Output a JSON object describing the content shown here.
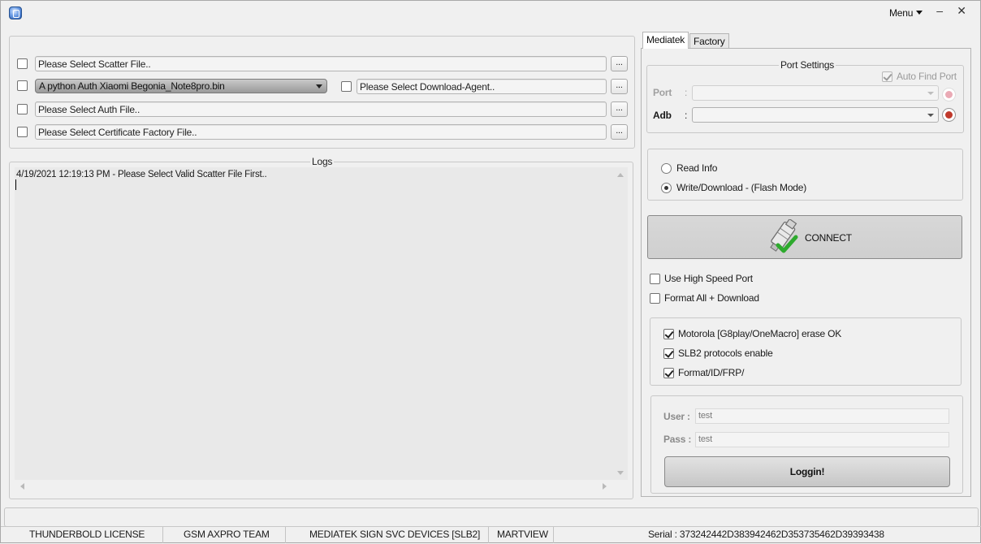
{
  "titlebar": {
    "menu_label": "Menu",
    "minimize_glyph": "–",
    "close_glyph": "✕"
  },
  "files": {
    "scatter_placeholder": "Please Select Scatter File..",
    "preset_selected": "A python Auth Xiaomi Begonia_Note8pro.bin",
    "download_agent_placeholder": "Please Select Download-Agent..",
    "auth_placeholder": "Please Select Auth File..",
    "certificate_placeholder": "Please Select Certificate Factory File..",
    "browse_label": "..."
  },
  "logs": {
    "title": "Logs",
    "lines": [
      "4/19/2021 12:19:13 PM - Please Select Valid Scatter File First.."
    ]
  },
  "tabs": [
    {
      "label": "Mediatek",
      "active": true
    },
    {
      "label": "Factory",
      "active": false
    }
  ],
  "port_settings": {
    "title": "Port Settings",
    "auto_find_label": "Auto Find Port",
    "auto_find_checked": true,
    "port_label": "Port",
    "adb_label": "Adb",
    "colon": ":"
  },
  "mode": {
    "read_info": "Read Info",
    "write_download": "Write/Download - (Flash Mode)",
    "selected": "write_download"
  },
  "connect": {
    "label": "CONNECT"
  },
  "options": {
    "high_speed": "Use High Speed Port",
    "format_all": "Format All + Download"
  },
  "features": [
    {
      "label": "Motorola [G8play/OneMacro] erase OK",
      "checked": true
    },
    {
      "label": "SLB2 protocols enable",
      "checked": true
    },
    {
      "label": "Format/ID/FRP/",
      "checked": true
    }
  ],
  "login": {
    "user_label": "User :",
    "user_value": "test",
    "pass_label": "Pass :",
    "pass_value": "test",
    "button_label": "Loggin!"
  },
  "statusbar": {
    "license": "THUNDERBOLD LICENSE",
    "team": "GSM AXPRO TEAM",
    "devices": "MEDIATEK SIGN SVC DEVICES [SLB2]",
    "brand": "MARTVIEW",
    "serial": "Serial : 373242442D383942462D353735462D39393438"
  },
  "colors": {
    "window_bg": "#f0f0f0",
    "connect_check": "#2eaa2e",
    "plug_red": "#c0392b"
  }
}
